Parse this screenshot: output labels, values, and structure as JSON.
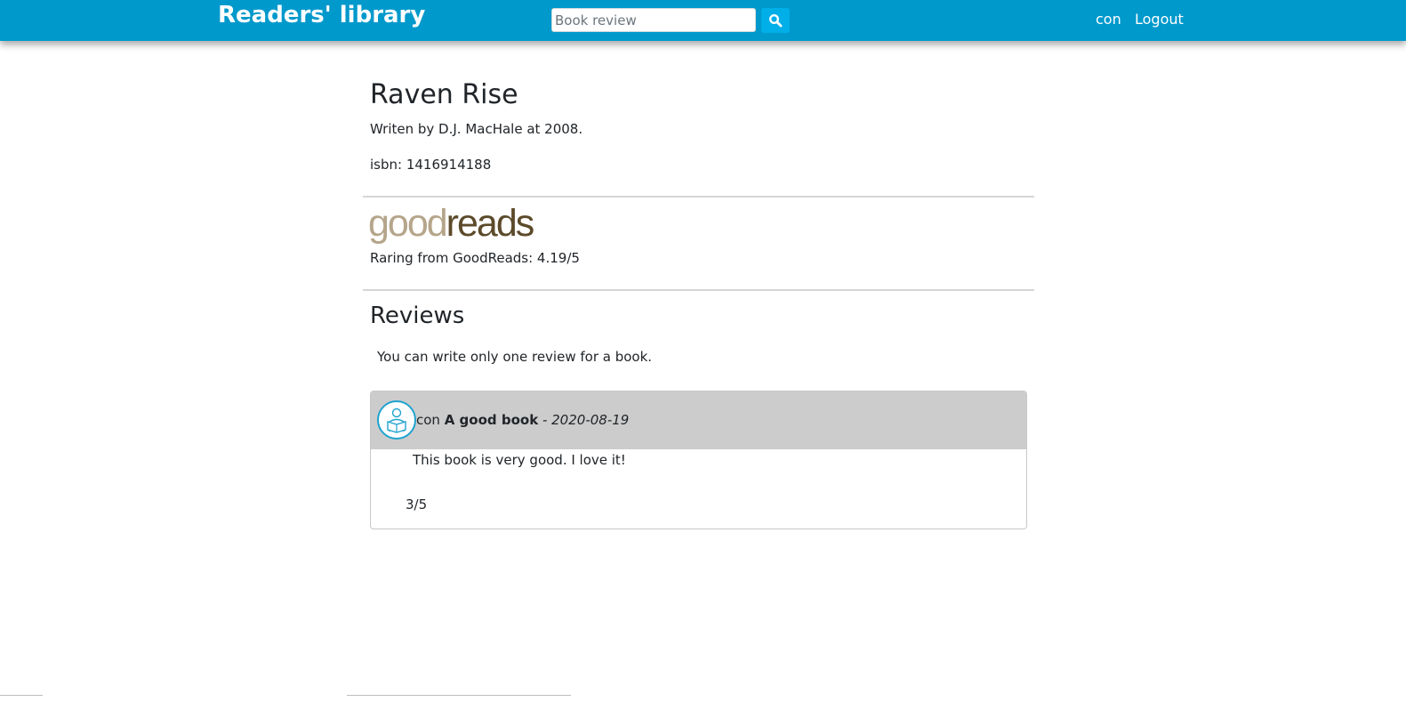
{
  "navbar": {
    "brand": "Readers' library",
    "search_placeholder": "Book review",
    "search_icon": "search-icon",
    "user": "con",
    "logout": "Logout",
    "background_color": "#0099cc",
    "search_button_color": "#00aee8"
  },
  "book": {
    "title": "Raven Rise",
    "author_line": "Writen by D.J. MacHale at 2008.",
    "isbn_line": "isbn: 1416914188"
  },
  "goodreads": {
    "logo_good": "good",
    "logo_reads": "reads",
    "rating_line": "Raring from GoodReads: 4.19/5"
  },
  "reviews": {
    "heading": "Reviews",
    "note": "You can write only one review for a book.",
    "items": [
      {
        "avatar_icon": "reader-avatar-icon",
        "user": "con",
        "title": "A good book",
        "separator": " - ",
        "date": "2020-08-19",
        "body": "This book is very good. I love it!",
        "score": "3/5"
      }
    ]
  }
}
